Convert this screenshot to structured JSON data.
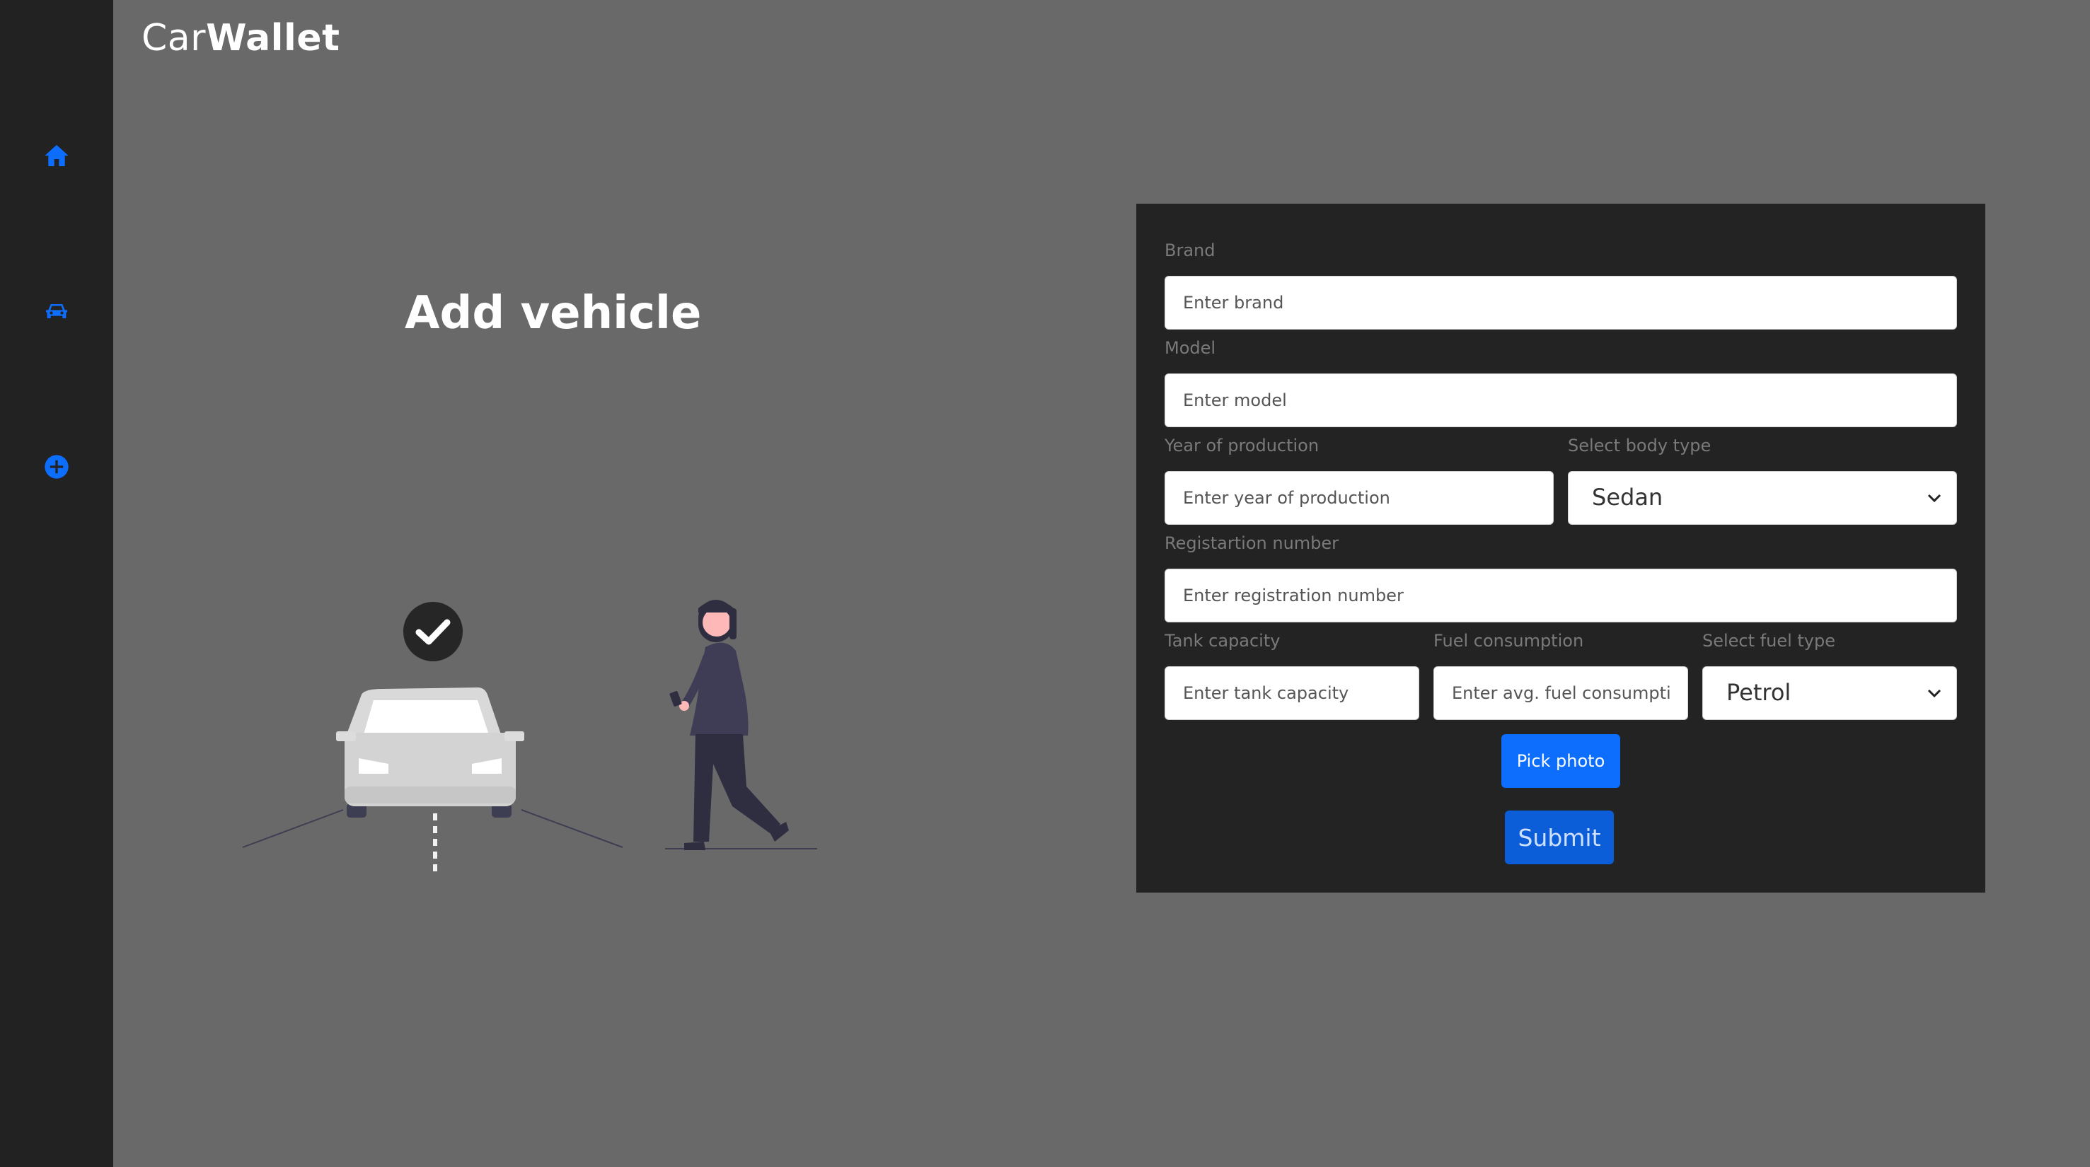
{
  "app": {
    "brand_part1": "Car",
    "brand_part2": "Wallet"
  },
  "sidebar": {
    "items": [
      {
        "icon": "home-icon"
      },
      {
        "icon": "car-icon"
      },
      {
        "icon": "plus-circle-icon"
      }
    ],
    "icon_color": "#0d6efd"
  },
  "page": {
    "title": "Add vehicle"
  },
  "form": {
    "brand": {
      "label": "Brand",
      "placeholder": "Enter brand"
    },
    "model": {
      "label": "Model",
      "placeholder": "Enter model"
    },
    "year": {
      "label": "Year of production",
      "placeholder": "Enter year of production"
    },
    "body_type": {
      "label": "Select body type",
      "value": "Sedan"
    },
    "registration": {
      "label": "Registartion number",
      "placeholder": "Enter registration number"
    },
    "tank": {
      "label": "Tank capacity",
      "placeholder": "Enter tank capacity"
    },
    "fuel_consumption": {
      "label": "Fuel consumption",
      "placeholder": "Enter avg. fuel consumption"
    },
    "fuel_type": {
      "label": "Select fuel type",
      "value": "Petrol"
    },
    "pick_photo_label": "Pick photo",
    "submit_label": "Submit"
  },
  "colors": {
    "background": "#696969",
    "sidebar": "#222222",
    "panel": "#232323",
    "primary": "#0d6efd"
  }
}
